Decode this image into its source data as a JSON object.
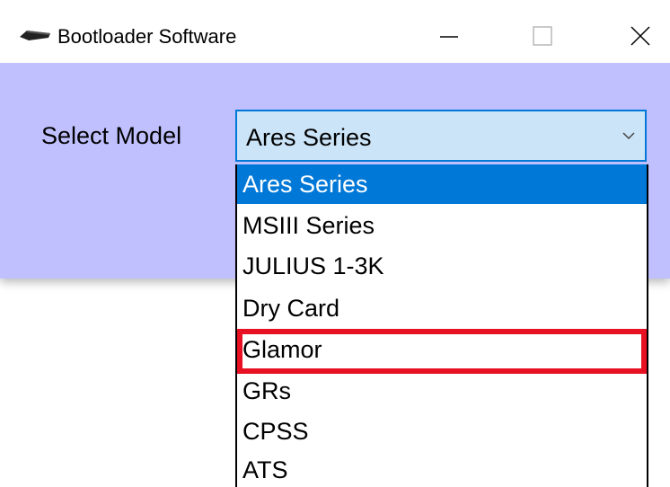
{
  "window": {
    "title": "Bootloader Software",
    "icon": "chip-icon",
    "controls": {
      "minimize_icon": "minimize-icon",
      "maximize_icon": "maximize-icon",
      "close_icon": "close-icon"
    }
  },
  "form": {
    "label": "Select Model",
    "selected_value": "Ares Series",
    "arrow_icon": "chevron-down-icon"
  },
  "dropdown": {
    "options": [
      "Ares Series",
      "MSIII Series",
      "JULIUS 1-3K",
      "Dry Card",
      "Glamor",
      "GRs",
      "CPSS",
      "ATS"
    ],
    "selected_index": 0,
    "highlighted_option": "Glamor"
  },
  "colors": {
    "client_background": "#c0c0ff",
    "combo_background": "#cce4f7",
    "selection_background": "#0078d7",
    "highlight_border": "#e81123"
  }
}
